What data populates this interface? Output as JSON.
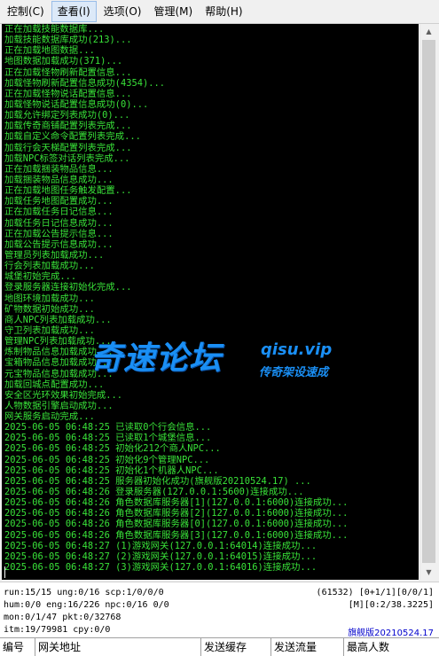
{
  "menu": [
    {
      "label": "控制(C)"
    },
    {
      "label": "查看(I)"
    },
    {
      "label": "选项(O)"
    },
    {
      "label": "管理(M)"
    },
    {
      "label": "帮助(H)"
    }
  ],
  "console": {
    "lines": [
      "正在加载技能数据库...",
      "加载技能数据库成功(213)...",
      "正在加载地图数据...",
      "地图数据加载成功(371)...",
      "正在加载怪物刷新配置信息...",
      "加载怪物刷新配置信息成功(4354)...",
      "正在加载怪物说话配置信息...",
      "加载怪物说话配置信息成功(0)...",
      "加载允许绑定列表成功(0)...",
      "加载传奇商铺配置列表完成...",
      "加载自定义命令配置列表完成...",
      "加载行会天梯配置列表完成...",
      "加载NPC标签对话列表完成...",
      "正在加载捆装物品信息...",
      "加载捆装物品信息成功...",
      "正在加载地图任务触发配置...",
      "加载任务地图配置成功...",
      "正在加载任务日记信息...",
      "加载任务日记信息成功...",
      "正在加载公告提示信息...",
      "加载公告提示信息成功...",
      "管理员列表加载成功...",
      "行会列表加载成功...",
      "城堡初始完成...",
      "登录服务器连接初始化完成...",
      "地图环境加载成功...",
      "矿物数据初始成功...",
      "商人NPC列表加载成功...",
      "守卫列表加载成功...",
      "管理NPC列表加载成功...",
      "炼制物品信息加载成功...",
      "宝箱物品信息加载成功...",
      "元宝物品信息加载成功...",
      "加载回城点配置成功...",
      "安全区光环效果初始完成...",
      "人物数据引擎启动成功...",
      "网关服务启动完成...",
      "2025-06-05 06:48:25 已读取0个行会信息...",
      "2025-06-05 06:48:25 已读取1个城堡信息...",
      "2025-06-05 06:48:25 初始化212个商人NPC...",
      "2025-06-05 06:48:25 初始化9个管理NPC...",
      "2025-06-05 06:48:25 初始化1个机器人NPC...",
      "2025-06-05 06:48:25 服务器初始化成功(旗舰版20210524.17) ...",
      "2025-06-05 06:48:26 登录服务器(127.0.0.1:5600)连接成功...",
      "2025-06-05 06:48:26 角色数据库服务器[1](127.0.0.1:6000)连接成功...",
      "2025-06-05 06:48:26 角色数据库服务器[2](127.0.0.1:6000)连接成功...",
      "2025-06-05 06:48:26 角色数据库服务器[0](127.0.0.1:6000)连接成功...",
      "2025-06-05 06:48:26 角色数据库服务器[3](127.0.0.1:6000)连接成功...",
      "2025-06-05 06:48:27 (1)游戏网关(127.0.0.1:64014)连接成功...",
      "2025-06-05 06:48:27 (2)游戏网关(127.0.0.1:64015)连接成功...",
      "2025-06-05 06:48:27 (3)游戏网关(127.0.0.1:64016)连接成功..."
    ]
  },
  "watermark": {
    "brand": "奇速论坛",
    "url": "qisu.vip",
    "tagline": "传奇架设速成"
  },
  "stats": {
    "line1_left": "run:15/15 ung:0/16 scp:1/0/0/0",
    "line1_right": "(61532) [0+1/1][0/0/1]",
    "line2_left": "hum:0/0 eng:16/226 npc:0/16 0/0",
    "line2_right": "[M][0:2/38.3225]",
    "line3_left": "mon:0/1/47 pkt:0/32768",
    "line4_left": "itm:19/79981 cpy:0/0",
    "version": "旗舰版20210524.17"
  },
  "table": {
    "columns": [
      "编号",
      "网关地址",
      "发送缓存",
      "发送流量",
      "最高人数"
    ]
  }
}
